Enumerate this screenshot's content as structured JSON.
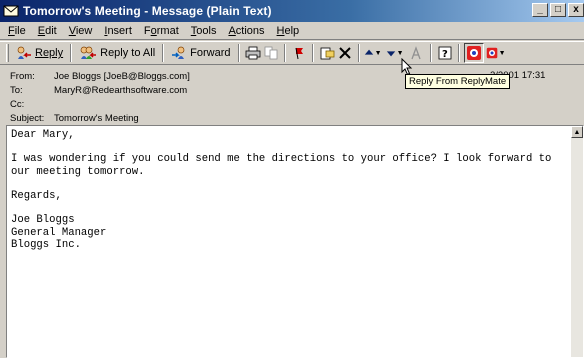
{
  "window": {
    "title": "Tomorrow's Meeting - Message (Plain Text)",
    "buttons": [
      "_",
      "□",
      "x"
    ]
  },
  "menu": [
    {
      "pre": "",
      "key": "F",
      "post": "ile"
    },
    {
      "pre": "",
      "key": "E",
      "post": "dit"
    },
    {
      "pre": "",
      "key": "V",
      "post": "iew"
    },
    {
      "pre": "",
      "key": "I",
      "post": "nsert"
    },
    {
      "pre": "F",
      "key": "o",
      "post": "rmat"
    },
    {
      "pre": "",
      "key": "T",
      "post": "ools"
    },
    {
      "pre": "",
      "key": "A",
      "post": "ctions"
    },
    {
      "pre": "",
      "key": "H",
      "post": "elp"
    }
  ],
  "toolbar": {
    "reply_label": "Reply",
    "reply_all_label": "Reply to All",
    "forward_label": "Forward"
  },
  "tooltip": "Reply From ReplyMate",
  "headers": {
    "from_label": "From:",
    "from_value": "Joe Bloggs [JoeB@Bloggs.com]",
    "to_label": "To:",
    "to_value": "MaryR@Redearthsoftware.com",
    "cc_label": "Cc:",
    "cc_value": "",
    "subject_label": "Subject:",
    "subject_value": "Tomorrow's Meeting",
    "sent_value_visible": "2/2001 17:31"
  },
  "body": {
    "text": "Dear Mary,\n\nI was wondering if you could send me the directions to your office? I look forward to\nour meeting tomorrow.\n\nRegards,\n\nJoe Bloggs\nGeneral Manager\nBloggs Inc."
  }
}
